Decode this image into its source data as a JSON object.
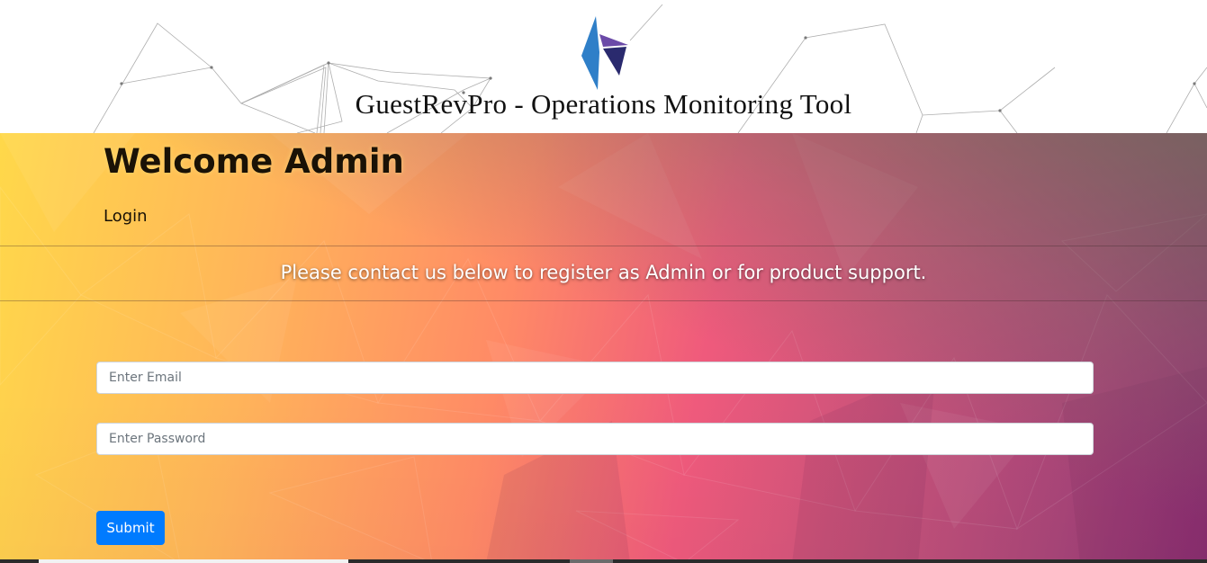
{
  "header": {
    "app_title": "GuestRevPro - Operations Monitoring Tool",
    "logo_icon": "guestrevpro-logo-icon"
  },
  "hero": {
    "welcome_title": "Welcome Admin",
    "login_label": "Login",
    "contact_text": "Please contact us below to register as Admin or for product support."
  },
  "form": {
    "email_placeholder": "Enter Email",
    "email_value": "",
    "password_placeholder": "Enter Password",
    "password_value": "",
    "submit_label": "Submit"
  },
  "colors": {
    "submit_bg": "#007bff",
    "logo_blue": "#2f7fc8",
    "logo_purple": "#6b4aa8",
    "logo_navy": "#2a2a6e"
  }
}
